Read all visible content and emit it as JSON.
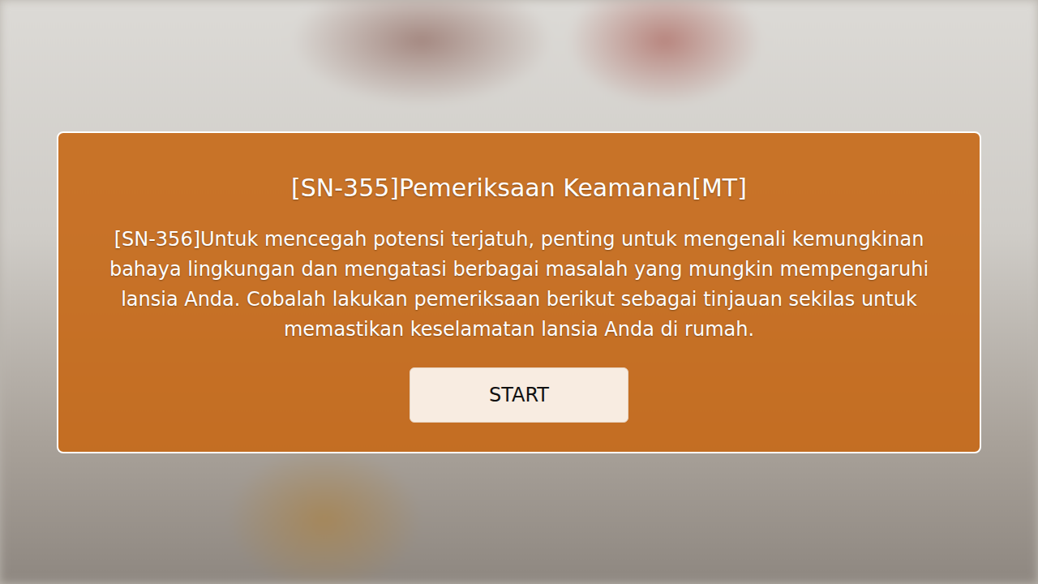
{
  "dialog": {
    "title": "[SN-355]Pemeriksaan Keamanan[MT]",
    "body": "[SN-356]Untuk mencegah potensi terjatuh, penting untuk mengenali kemungkinan bahaya lingkungan dan mengatasi berbagai masalah yang mungkin mempengaruhi lansia Anda. Cobalah lakukan pemeriksaan berikut sebagai tinjauan sekilas untuk memastikan keselamatan lansia Anda di rumah.",
    "button": {
      "label": "START"
    }
  }
}
